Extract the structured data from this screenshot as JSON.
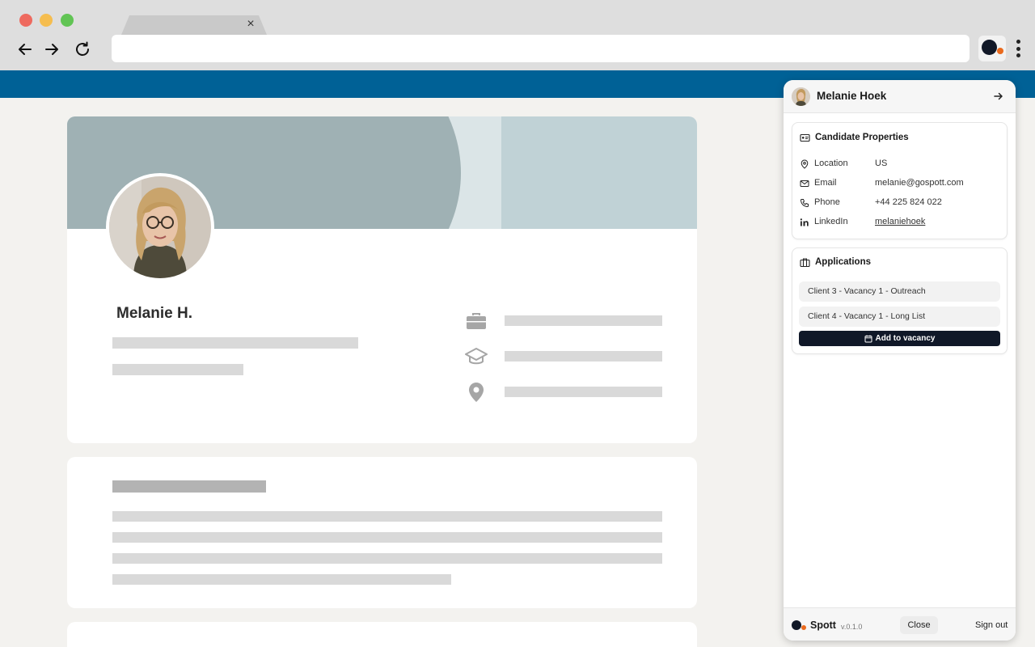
{
  "browser": {
    "tab_close": "×"
  },
  "profile": {
    "name": "Melanie H."
  },
  "panel": {
    "candidate_name": "Melanie Hoek",
    "properties_title": "Candidate Properties",
    "properties": [
      {
        "label": "Location",
        "value": "US"
      },
      {
        "label": "Email",
        "value": "melanie@gospott.com"
      },
      {
        "label": "Phone",
        "value": "+44 225 824 022"
      },
      {
        "label": "LinkedIn",
        "value": "melaniehoek"
      }
    ],
    "applications_title": "Applications",
    "applications": [
      "Client 3 - Vacancy 1 - Outreach",
      "Client 4 - Vacancy 1 - Long List"
    ],
    "add_button_label": "Add to vacancy",
    "footer": {
      "brand": "Spott",
      "version": "v.0.1.0",
      "close_label": "Close",
      "signout_label": "Sign out"
    }
  },
  "colors": {
    "header_blue": "#006196",
    "accent_orange": "#ea6a1d",
    "brand_navy": "#111827"
  }
}
